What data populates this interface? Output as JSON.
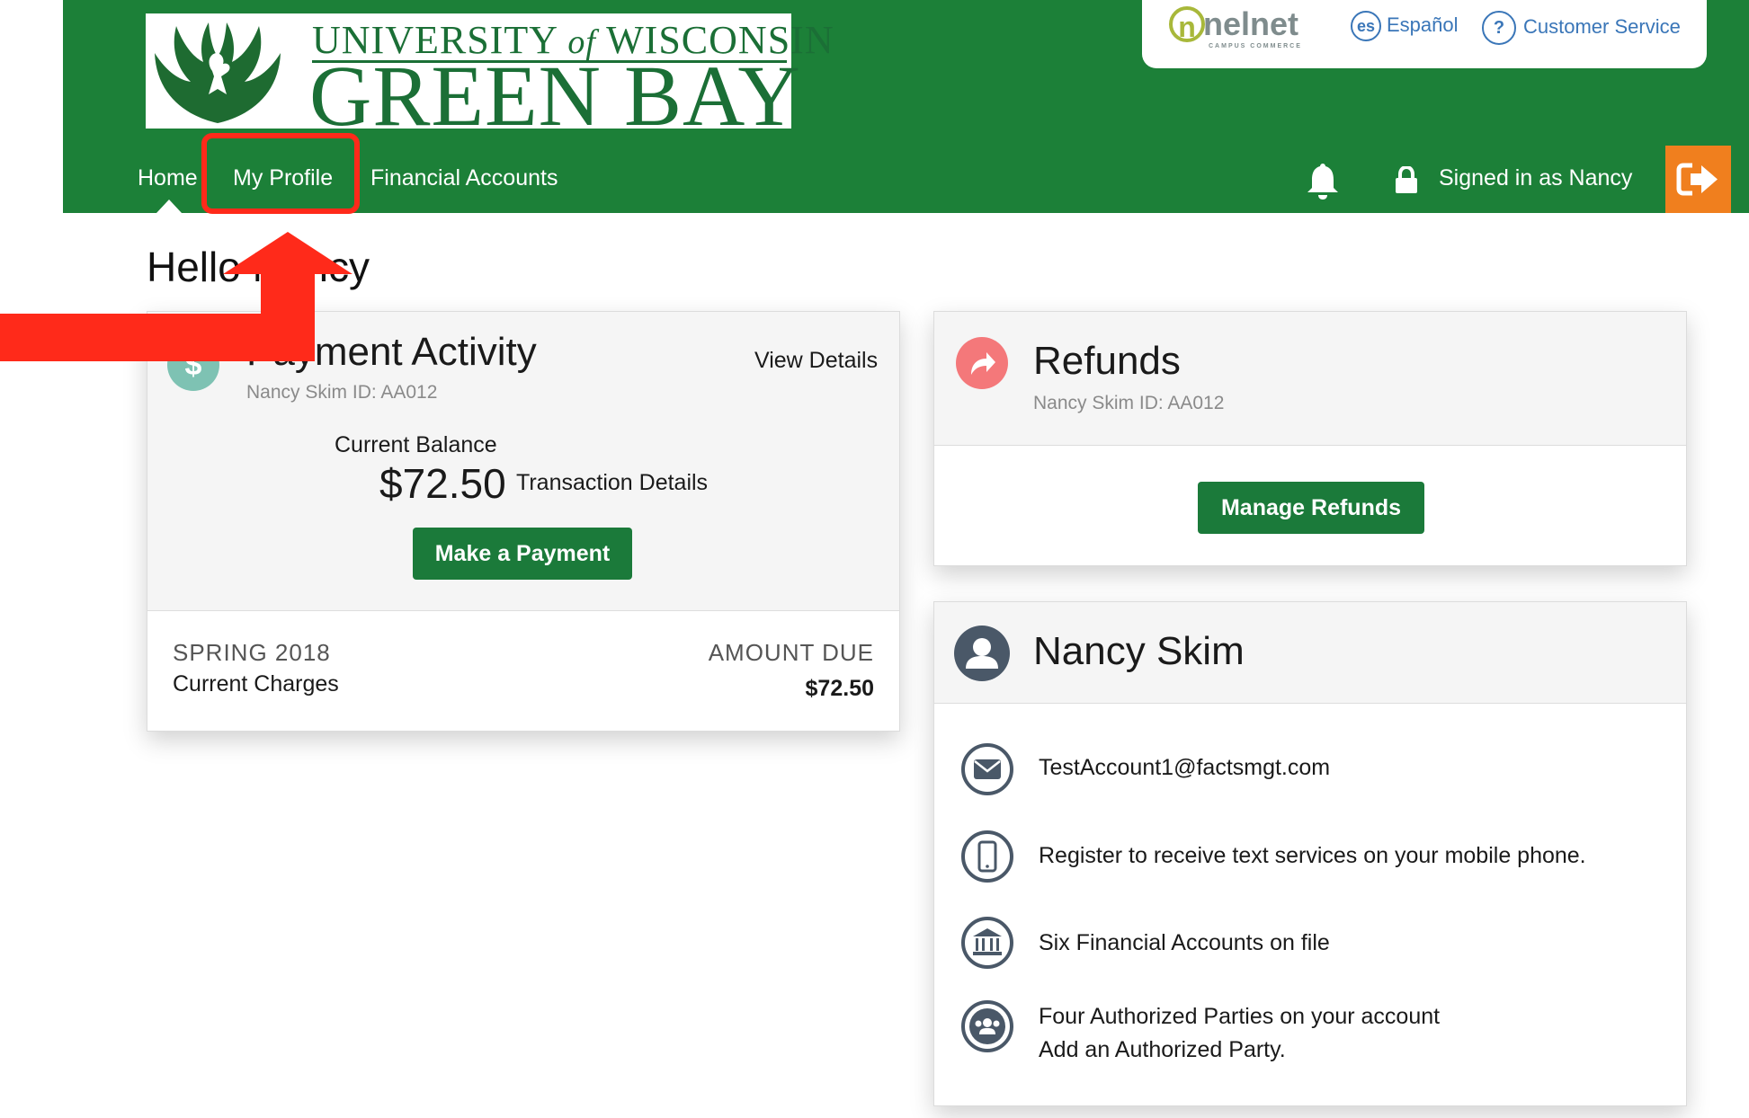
{
  "brand": {
    "university_line": [
      "UNIVERSITY",
      "of",
      "WISCONSIN"
    ],
    "campus": "GREEN BAY",
    "color": "#1c8038"
  },
  "utility": {
    "nelnet_logo": "nelnet",
    "nelnet_sub": "CAMPUS COMMERCE",
    "language_badge": "es",
    "language": "Español",
    "help_badge": "?",
    "customer_service": "Customer Service"
  },
  "nav": {
    "items": [
      "Home",
      "My Profile",
      "Financial Accounts"
    ],
    "signed_in": "Signed in as Nancy",
    "icons": [
      "bell-icon",
      "lock-icon",
      "logout-icon"
    ],
    "logout_color": "#f07f1e"
  },
  "greeting": "Hello Nancy",
  "payment_activity": {
    "icon_glyph": "$",
    "title": "Payment Activity",
    "id_line": "Nancy Skim ID: AA012",
    "view_details": "View Details",
    "balance_label": "Current Balance",
    "balance": "$72.50",
    "transaction_details": "Transaction Details",
    "pay_button": "Make a Payment",
    "term": "SPRING 2018",
    "charges_label": "Current Charges",
    "amount_due_label": "AMOUNT DUE",
    "amount_due": "$72.50"
  },
  "refunds": {
    "title": "Refunds",
    "id_line": "Nancy Skim ID: AA012",
    "button": "Manage Refunds"
  },
  "profile": {
    "name": "Nancy Skim",
    "email": "TestAccount1@factsmgt.com",
    "sms": "Register to receive text services on your mobile phone.",
    "accounts": "Six Financial Accounts on file",
    "parties": "Four Authorized Parties on your account",
    "add_party": "Add an Authorized Party."
  },
  "annotation": {
    "color": "#ff2a1a"
  }
}
